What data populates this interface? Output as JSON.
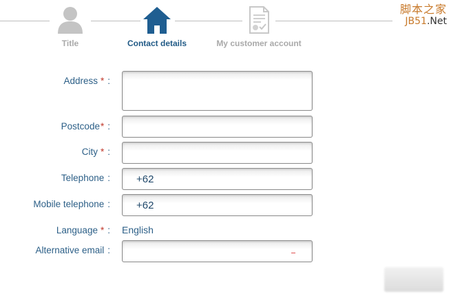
{
  "steps": [
    {
      "label": "Title",
      "icon": "person-icon",
      "state": "inactive"
    },
    {
      "label": "Contact details",
      "icon": "house-icon",
      "state": "active"
    },
    {
      "label": "My customer account",
      "icon": "certificate-icon",
      "state": "inactive"
    }
  ],
  "watermark": {
    "line1": "脚本之家",
    "line2_prefix": "JB51",
    "line2_suffix": ".Net"
  },
  "form": {
    "address": {
      "label": "Address",
      "required": "*",
      "colon": ":",
      "value": ""
    },
    "postcode": {
      "label": "Postcode",
      "required": "*",
      "colon": ":",
      "value": ""
    },
    "city": {
      "label": "City",
      "required": "*",
      "colon": ":",
      "value": ""
    },
    "telephone": {
      "label": "Telephone",
      "colon": ":",
      "value": "+62"
    },
    "mobile": {
      "label": "Mobile telephone",
      "colon": ":",
      "value": "+62"
    },
    "language": {
      "label": "Language",
      "required": "*",
      "colon": ":",
      "value": "English"
    },
    "alt_email": {
      "label": "Alternative email",
      "colon": ":",
      "value": ""
    }
  },
  "colors": {
    "accent": "#215a86",
    "label": "#2c5f87",
    "required": "#c0392b",
    "inactive": "#a9a9a9"
  }
}
